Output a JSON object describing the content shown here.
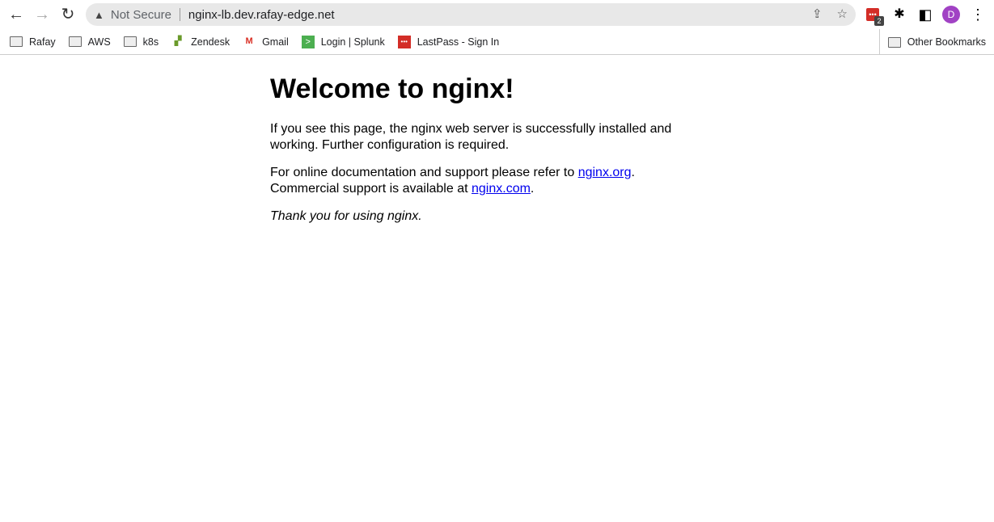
{
  "browser": {
    "security_label": "Not Secure",
    "url": "nginx-lb.dev.rafay-edge.net",
    "extension_badge": "2",
    "profile_initial": "D",
    "bookmarks": [
      {
        "label": "Rafay",
        "icon": "folder-icon"
      },
      {
        "label": "AWS",
        "icon": "folder-icon"
      },
      {
        "label": "k8s",
        "icon": "folder-icon"
      },
      {
        "label": "Zendesk",
        "icon": "zendesk-icon"
      },
      {
        "label": "Gmail",
        "icon": "gmail-icon"
      },
      {
        "label": "Login | Splunk",
        "icon": "splunk-icon"
      },
      {
        "label": "LastPass - Sign In",
        "icon": "lastpass-icon"
      }
    ],
    "other_bookmarks": "Other Bookmarks"
  },
  "page": {
    "title": "Welcome to nginx!",
    "para1": "If you see this page, the nginx web server is successfully installed and working. Further configuration is required.",
    "para2_prefix": "For online documentation and support please refer to ",
    "link_org": "nginx.org",
    "para2_mid": ".",
    "para2_line2": "Commercial support is available at ",
    "link_com": "nginx.com",
    "para2_end": ".",
    "thanks": "Thank you for using nginx."
  }
}
